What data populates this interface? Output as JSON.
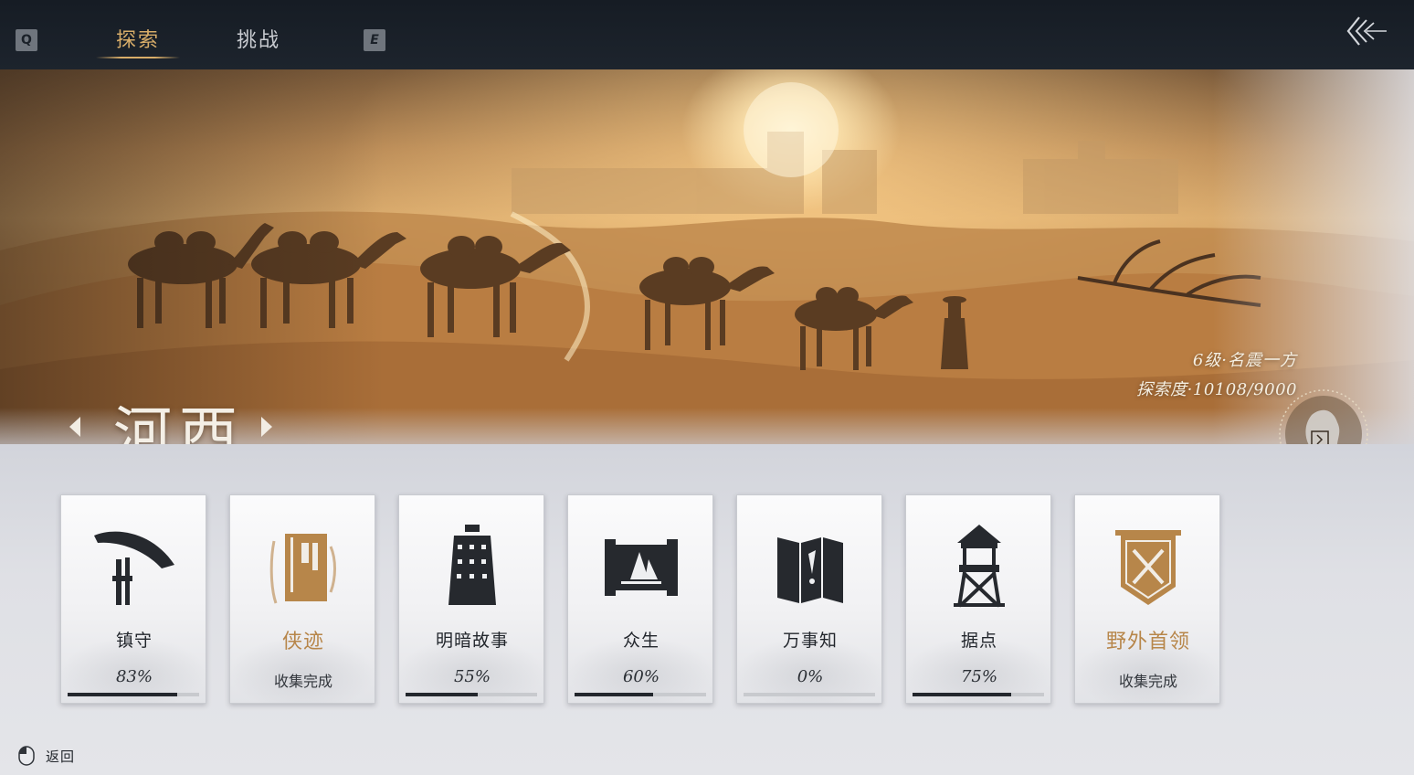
{
  "header": {
    "key_left": "Q",
    "key_right": "E",
    "tabs": [
      {
        "label": "探索",
        "active": true
      },
      {
        "label": "挑战",
        "active": false
      }
    ],
    "back_icon": "triple-chevron-left-icon"
  },
  "banner": {
    "region_name": "河西",
    "level_text": "6级·名震一方",
    "progress_text": "探索度·10108/9000",
    "map_icon": "region-map-badge-icon"
  },
  "cards": [
    {
      "label": "镇守",
      "status": "83%",
      "progress": 0.83,
      "icon": "hat-icon",
      "complete": false
    },
    {
      "label": "侠迹",
      "status": "收集完成",
      "progress": 1.0,
      "icon": "book-icon",
      "complete": true
    },
    {
      "label": "明暗故事",
      "status": "55%",
      "progress": 0.55,
      "icon": "bell-icon",
      "complete": false
    },
    {
      "label": "众生",
      "status": "60%",
      "progress": 0.6,
      "icon": "scroll-painting-icon",
      "complete": false
    },
    {
      "label": "万事知",
      "status": "0%",
      "progress": 0.0,
      "icon": "folding-screen-icon",
      "complete": false
    },
    {
      "label": "据点",
      "status": "75%",
      "progress": 0.75,
      "icon": "watchtower-icon",
      "complete": false
    },
    {
      "label": "野外首领",
      "status": "收集完成",
      "progress": 1.0,
      "icon": "crossed-swords-banner-icon",
      "complete": true
    }
  ],
  "footer": {
    "back_label": "返回"
  },
  "colors": {
    "accent_gold": "#d8ad69",
    "card_gold": "#b7864a",
    "topbar": "#1a2029"
  }
}
